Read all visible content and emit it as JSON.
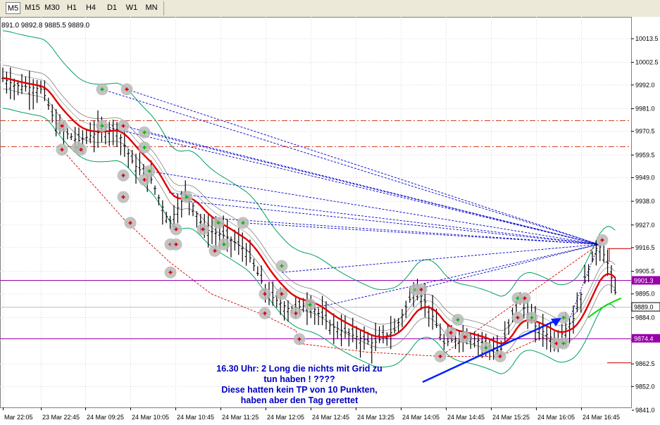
{
  "toolbar": {
    "timeframes": [
      "M5",
      "M15",
      "M30",
      "H1",
      "H4",
      "D1",
      "W1",
      "MN"
    ],
    "active": "M5"
  },
  "ohlc_text": "891.0 9892.8 9885.5 9889.0",
  "colors": {
    "ema": "#e00000",
    "envelope": "#00a060",
    "dashed_blue": "#0000cc",
    "dashed_red": "#cc0000",
    "h_orange": "#d04020",
    "h_purple": "#9900aa",
    "arrow": "#0020ff",
    "green_line": "#00e000"
  },
  "chart_data": {
    "type": "candlestick",
    "y_ticks": [
      "10013.5",
      "10002.5",
      "9992.0",
      "9981.0",
      "9970.5",
      "9959.5",
      "9949.0",
      "9938.0",
      "9927.0",
      "9916.5",
      "9905.5",
      "9895.0",
      "9884.0",
      "9873.5",
      "9862.5",
      "9852.0",
      "9841.0"
    ],
    "ylim": [
      9841.0,
      10013.5
    ],
    "x_ticks": [
      "Mar 22:05",
      "23 Mar 22:45",
      "24 Mar 09:25",
      "24 Mar 10:05",
      "24 Mar 10:45",
      "24 Mar 11:25",
      "24 Mar 12:05",
      "24 Mar 12:45",
      "24 Mar 13:25",
      "24 Mar 14:05",
      "24 Mar 14:45",
      "24 Mar 15:25",
      "24 Mar 16:05",
      "24 Mar 16:45"
    ],
    "price_labels": [
      {
        "text": "9901.3",
        "value": 9901.3,
        "color": "#9900aa"
      },
      {
        "text": "9889.0",
        "value": 9889.0,
        "color": "#000000"
      },
      {
        "text": "9874.4",
        "value": 9874.4,
        "color": "#9900aa"
      }
    ],
    "horizontal_lines": [
      {
        "value": 9975.5,
        "style": "dashdot",
        "color": "#d04020"
      },
      {
        "value": 9963.5,
        "style": "dashdot",
        "color": "#d04020"
      },
      {
        "value": 9901.3,
        "style": "solid",
        "color": "#9900aa"
      },
      {
        "value": 9889.0,
        "style": "solid",
        "color": "#c0c0c0"
      },
      {
        "value": 9874.4,
        "style": "solid",
        "color": "#9900aa"
      }
    ],
    "grid": true
  },
  "annotation": {
    "lines": [
      "16.30 Uhr: 2 Long die nichts mit Grid zu",
      "tun haben ! ????",
      "Diese hatten kein TP von 10 Punkten,",
      "haben aber den Tag gerettet"
    ]
  }
}
